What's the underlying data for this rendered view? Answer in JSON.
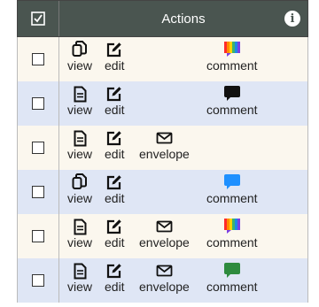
{
  "header": {
    "title": "Actions",
    "info_icon": "info-icon"
  },
  "labels": {
    "view": "view",
    "edit": "edit",
    "envelope": "envelope",
    "comment": "comment"
  },
  "rows": [
    {
      "view_icon": "copy-icon",
      "has_envelope": false,
      "comment_color": "rainbow"
    },
    {
      "view_icon": "document-icon",
      "has_envelope": false,
      "comment_color": "#111111"
    },
    {
      "view_icon": "document-icon",
      "has_envelope": true,
      "comment_color": ""
    },
    {
      "view_icon": "copy-icon",
      "has_envelope": false,
      "comment_color": "#1e90ff"
    },
    {
      "view_icon": "document-icon",
      "has_envelope": true,
      "comment_color": "rainbow"
    },
    {
      "view_icon": "document-icon",
      "has_envelope": true,
      "comment_color": "#2e8b3e"
    }
  ]
}
